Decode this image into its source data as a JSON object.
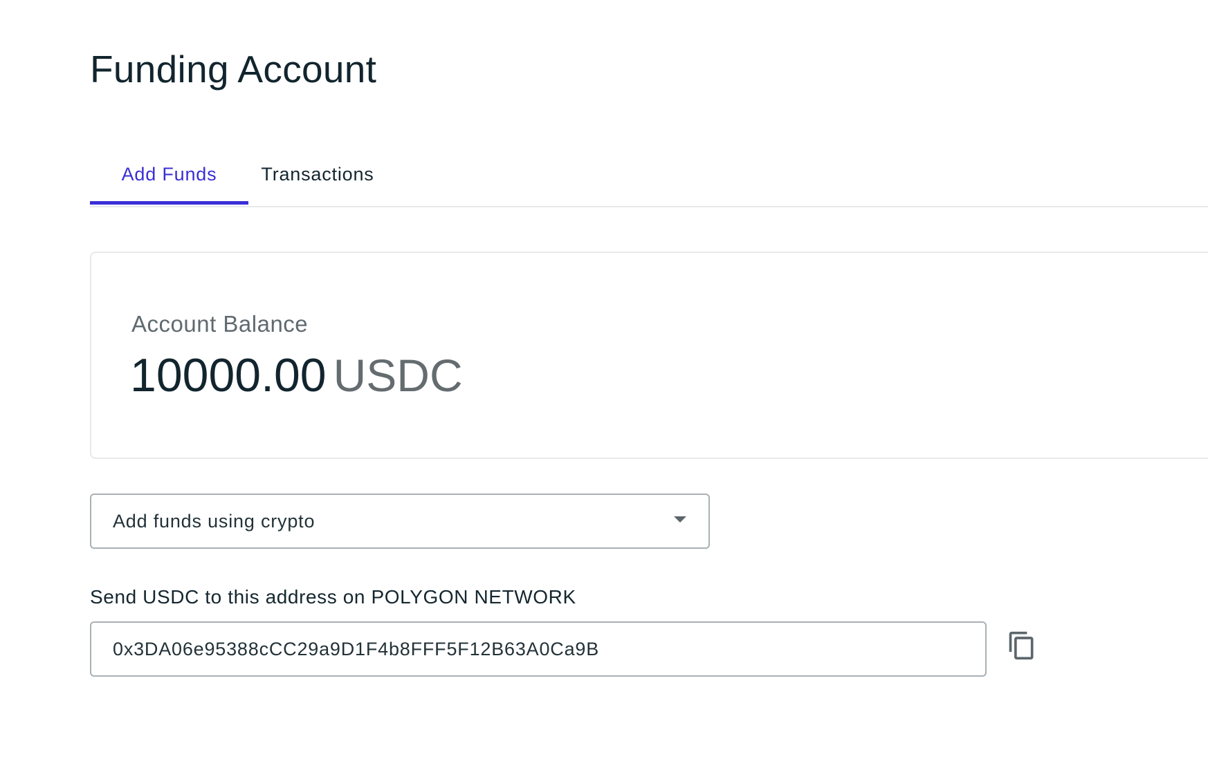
{
  "header": {
    "title": "Funding Account"
  },
  "tabs": [
    {
      "label": "Add Funds",
      "active": true
    },
    {
      "label": "Transactions",
      "active": false
    }
  ],
  "balance": {
    "label": "Account Balance",
    "amount": "10000.00",
    "currency": "USDC"
  },
  "funding_method": {
    "selected": "Add funds using crypto"
  },
  "deposit": {
    "label": "Send USDC to this address on POLYGON NETWORK",
    "address": "0x3DA06e95388cCC29a9D1F4b8FFF5F12B63A0Ca9B"
  },
  "icons": {
    "dropdown": "chevron-down-icon",
    "copy": "copy-icon"
  },
  "colors": {
    "accent": "#3a2ed6",
    "text_primary": "#12252e",
    "text_secondary": "#646c70",
    "border": "#a8b0b4"
  }
}
